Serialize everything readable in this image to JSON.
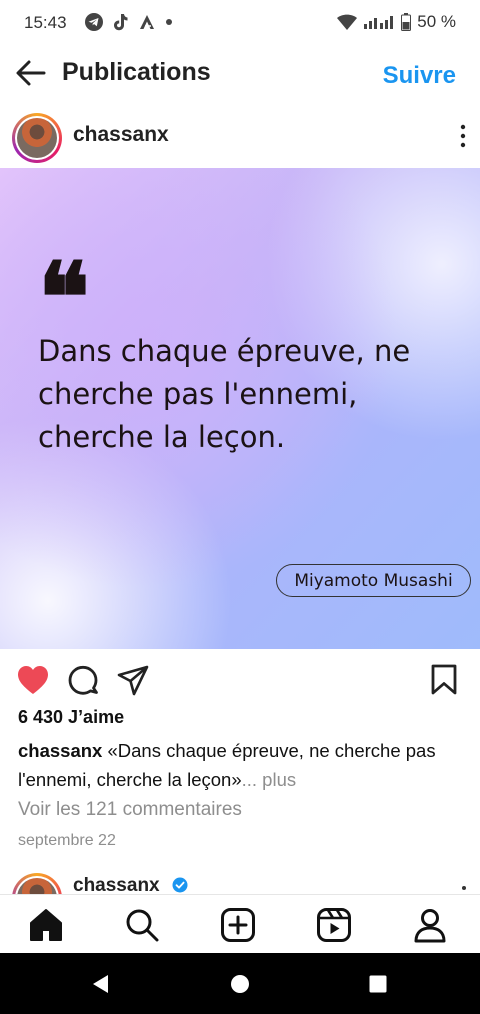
{
  "status_bar": {
    "time": "15:43",
    "left_icons": [
      "telegram-icon",
      "tiktok-icon",
      "a-icon",
      "dot-icon"
    ],
    "right_icons": [
      "wifi-icon",
      "signal-icon"
    ],
    "battery": "50 %"
  },
  "header": {
    "title": "Publications",
    "follow_label": "Suivre"
  },
  "post": {
    "username": "chassanx",
    "image": {
      "quote_mark": "❝",
      "quote_text": "Dans chaque épreuve, ne cherche pas l'ennemi, cherche la leçon.",
      "author": "Miyamoto Musashi"
    },
    "likes": "6 430 J’aime",
    "caption_user": "chassanx",
    "caption_text": "«Dans chaque épreuve, ne cherche pas l'ennemi, cherche la leçon»",
    "caption_more": "... plus",
    "comments_link": "Voir les 121 commentaires",
    "date": "septembre 22",
    "liked": true,
    "colors": {
      "like": "#ed4956",
      "follow": "#1a95f0",
      "verified": "#1a95f0"
    }
  },
  "next_post": {
    "username": "chassanx",
    "verified": true
  },
  "bottom_nav": {
    "items": [
      "home-icon",
      "search-icon",
      "create-icon",
      "reels-icon",
      "profile-icon"
    ]
  },
  "system_nav": {
    "items": [
      "back-triangle-icon",
      "home-circle-icon",
      "recents-square-icon"
    ]
  }
}
